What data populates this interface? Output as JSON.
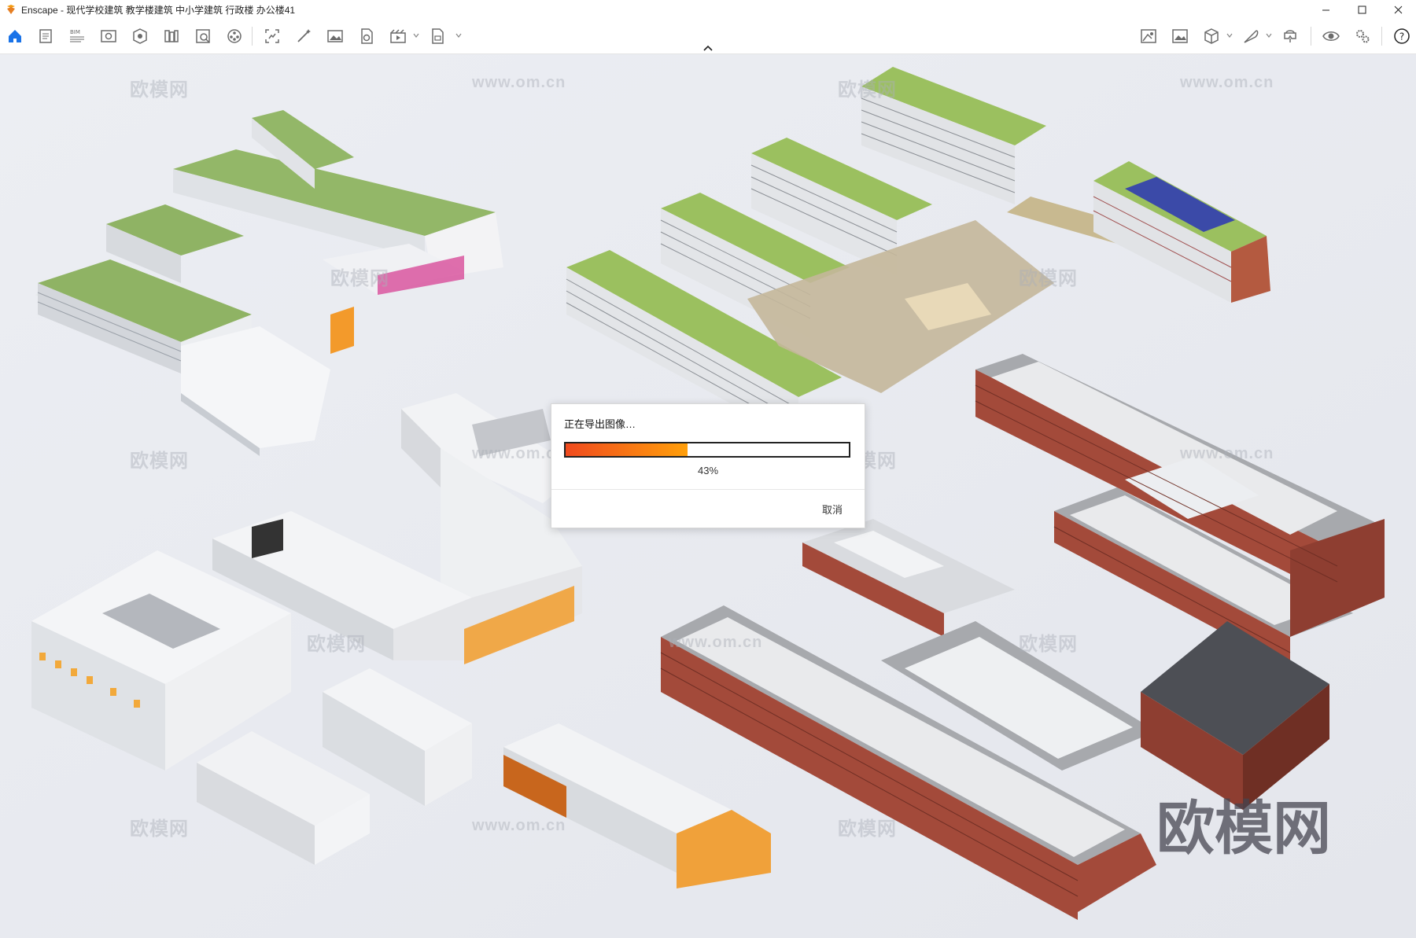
{
  "window": {
    "title": "Enscape - 现代学校建筑 教学楼建筑 中小学建筑 行政楼 办公楼41",
    "controls": [
      "minimize",
      "maximize",
      "close"
    ]
  },
  "toolbar": {
    "left_icons": [
      "home-icon",
      "notes-icon",
      "bim-info-icon",
      "views-icon",
      "sketch-mode-icon",
      "asset-library-icon",
      "material-editor-icon",
      "video-editor-icon",
      "capture-view-icon",
      "batch-render-icon",
      "screenshot-icon",
      "export-panorama-icon",
      "export-video-icon",
      "export-standalone-icon"
    ],
    "bim_label": "BIM",
    "right_icons": [
      "visual-settings-icon",
      "atmosphere-icon",
      "view-cube-icon",
      "feather-icon",
      "vr-headset-icon",
      "eye-icon",
      "settings-icon",
      "help-icon"
    ],
    "help_glyph": "?"
  },
  "dialog": {
    "title": "正在导出图像…",
    "progress": 0.43,
    "progress_text": "43%",
    "cancel_label": "取消"
  },
  "watermarks": {
    "brand": "欧模网",
    "url": "www.om.cn"
  },
  "colors": {
    "accent": "#1a73e8",
    "progress_start": "#f04a1e",
    "progress_end": "#ff9f0a"
  }
}
